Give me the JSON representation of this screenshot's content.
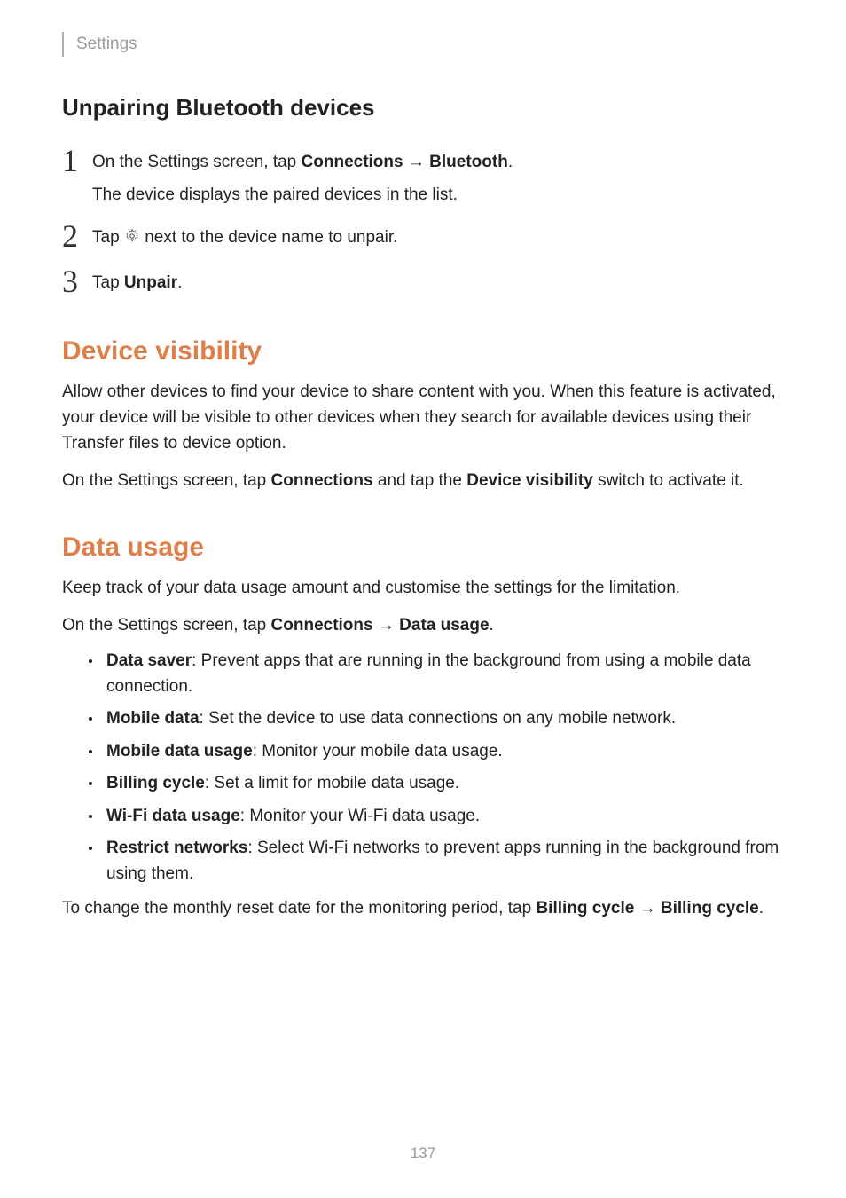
{
  "header": {
    "section": "Settings"
  },
  "unpairing": {
    "title": "Unpairing Bluetooth devices",
    "step1_pre": "On the Settings screen, tap ",
    "step1_b1": "Connections",
    "step1_arrow": " → ",
    "step1_b2": "Bluetooth",
    "step1_post": ".",
    "step1_sub": "The device displays the paired devices in the list.",
    "step2_pre": "Tap ",
    "step2_post": " next to the device name to unpair.",
    "step3_pre": "Tap ",
    "step3_b": "Unpair",
    "step3_post": "."
  },
  "visibility": {
    "title": "Device visibility",
    "p1": "Allow other devices to find your device to share content with you. When this feature is activated, your device will be visible to other devices when they search for available devices using their Transfer files to device option.",
    "p2_pre": "On the Settings screen, tap ",
    "p2_b1": "Connections",
    "p2_mid": " and tap the ",
    "p2_b2": "Device visibility",
    "p2_post": " switch to activate it."
  },
  "datausage": {
    "title": "Data usage",
    "p1": "Keep track of your data usage amount and customise the settings for the limitation.",
    "p2_pre": "On the Settings screen, tap ",
    "p2_b1": "Connections",
    "p2_arrow": " → ",
    "p2_b2": "Data usage",
    "p2_post": ".",
    "items": [
      {
        "b": "Data saver",
        "t": ": Prevent apps that are running in the background from using a mobile data connection."
      },
      {
        "b": "Mobile data",
        "t": ": Set the device to use data connections on any mobile network."
      },
      {
        "b": "Mobile data usage",
        "t": ": Monitor your mobile data usage."
      },
      {
        "b": "Billing cycle",
        "t": ": Set a limit for mobile data usage."
      },
      {
        "b": "Wi-Fi data usage",
        "t": ": Monitor your Wi-Fi data usage."
      },
      {
        "b": "Restrict networks",
        "t": ": Select Wi-Fi networks to prevent apps running in the background from using them."
      }
    ],
    "p3_pre": "To change the monthly reset date for the monitoring period, tap ",
    "p3_b1": "Billing cycle",
    "p3_arrow": " → ",
    "p3_b2": "Billing cycle",
    "p3_post": "."
  },
  "page_number": "137"
}
